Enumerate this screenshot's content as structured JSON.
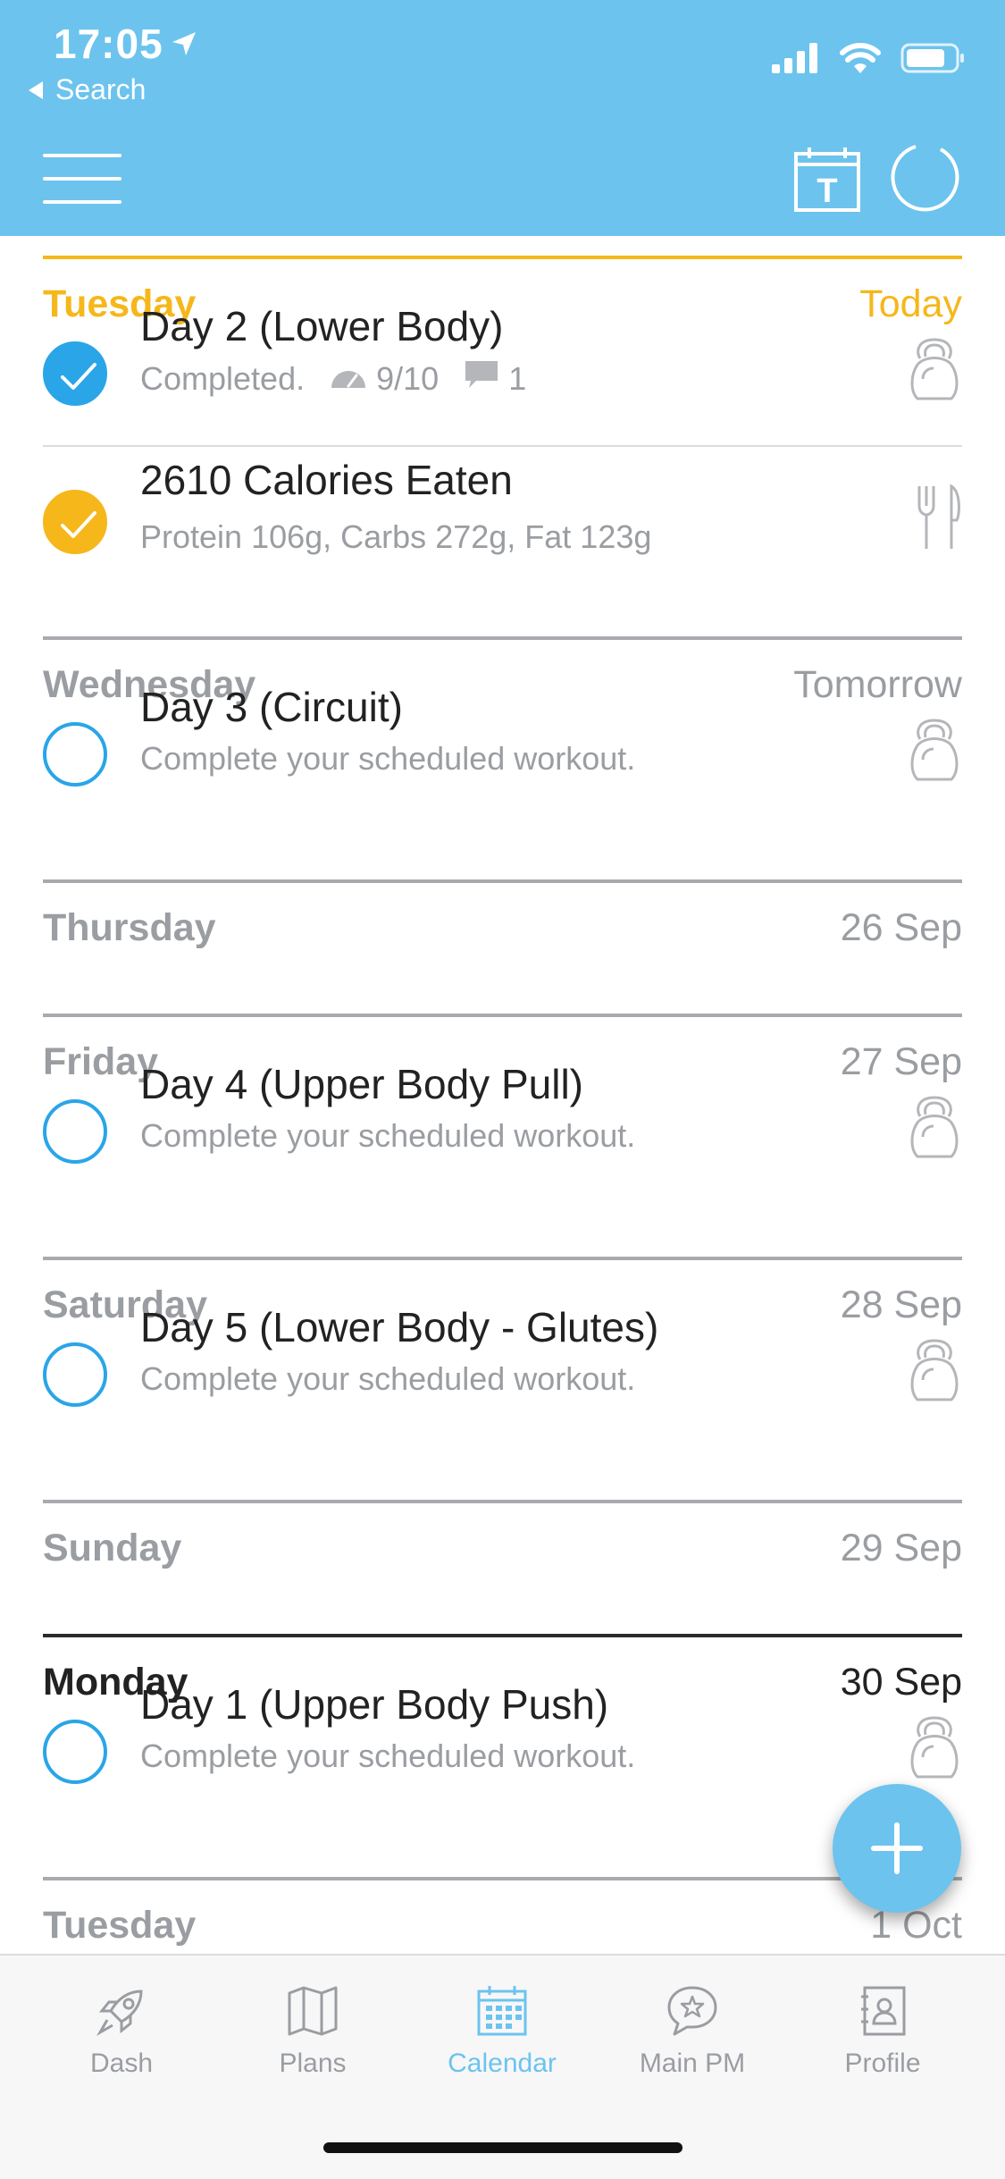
{
  "status_bar": {
    "time": "17:05",
    "back_label": "Search"
  },
  "header": {
    "today_button_letter": "T"
  },
  "days": [
    {
      "name": "Tuesday",
      "date": "Today",
      "style": "today",
      "items": [
        {
          "title": "Day 2 (Lower Body)",
          "subtitle": "Completed.",
          "rating": "9/10",
          "comments": "1",
          "state": "done",
          "icon": "kettlebell-icon"
        },
        {
          "title": "2610 Calories Eaten",
          "subtitle": "Protein 106g, Carbs 272g, Fat 123g",
          "state": "orange",
          "icon": "fork-knife-icon"
        }
      ]
    },
    {
      "name": "Wednesday",
      "date": "Tomorrow",
      "style": "normal",
      "items": [
        {
          "title": "Day 3 (Circuit)",
          "subtitle": "Complete your scheduled workout.",
          "state": "open",
          "icon": "kettlebell-icon"
        }
      ]
    },
    {
      "name": "Thursday",
      "date": "26 Sep",
      "style": "normal",
      "items": []
    },
    {
      "name": "Friday",
      "date": "27 Sep",
      "style": "normal",
      "items": [
        {
          "title": "Day 4 (Upper Body Pull)",
          "subtitle": "Complete your scheduled workout.",
          "state": "open",
          "icon": "kettlebell-icon"
        }
      ]
    },
    {
      "name": "Saturday",
      "date": "28 Sep",
      "style": "normal",
      "items": [
        {
          "title": "Day 5 (Lower Body - Glutes)",
          "subtitle": "Complete your scheduled workout.",
          "state": "open",
          "icon": "kettlebell-icon"
        }
      ]
    },
    {
      "name": "Sunday",
      "date": "29 Sep",
      "style": "normal",
      "items": []
    },
    {
      "name": "Monday",
      "date": "30 Sep",
      "style": "current",
      "items": [
        {
          "title": "Day 1 (Upper Body Push)",
          "subtitle": "Complete your scheduled workout.",
          "state": "open",
          "icon": "kettlebell-icon"
        }
      ]
    },
    {
      "name": "Tuesday",
      "date": "1 Oct",
      "style": "normal",
      "items": []
    }
  ],
  "tabbar": {
    "tabs": [
      {
        "label": "Dash",
        "icon": "rocket-icon"
      },
      {
        "label": "Plans",
        "icon": "map-icon"
      },
      {
        "label": "Calendar",
        "icon": "calendar-icon",
        "active": true
      },
      {
        "label": "Main PM",
        "icon": "chat-star-icon"
      },
      {
        "label": "Profile",
        "icon": "profile-book-icon"
      }
    ]
  },
  "colors": {
    "header": "#6cc3ee",
    "accent_blue": "#2aa5e8",
    "today_orange": "#f5b71a",
    "muted": "#9a9da1"
  }
}
